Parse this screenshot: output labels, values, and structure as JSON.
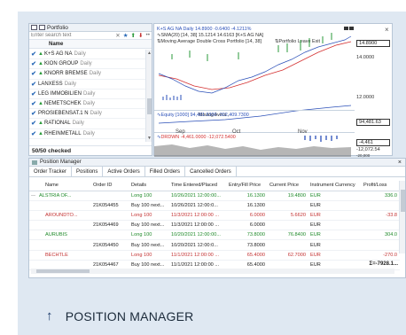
{
  "portfolio": {
    "title": "Portfolio",
    "search_placeholder": "Enter search text",
    "column_name": "Name",
    "items": [
      {
        "name": "K+S AG NA",
        "timeframe": "Daily"
      },
      {
        "name": "KION GROUP",
        "timeframe": "Daily"
      },
      {
        "name": "KNORR BREMSE",
        "timeframe": "Daily"
      },
      {
        "name": "LANXESS",
        "timeframe": "Daily"
      },
      {
        "name": "LEG IMMOBILIEN",
        "timeframe": "Daily"
      },
      {
        "name": "NEMETSCHEK",
        "timeframe": "Daily"
      },
      {
        "name": "PROSIEBENSAT.1 N",
        "timeframe": "Daily"
      },
      {
        "name": "RATIONAL",
        "timeframe": "Daily"
      },
      {
        "name": "RHEINMETALL",
        "timeframe": "Daily"
      }
    ],
    "footer": "50/50 checked"
  },
  "chart": {
    "header": "K+S AG NA  Daily 14.8900 -0.6400 -4.1211%",
    "sma_line": "SMA(20) [14, 38] 15.1214 14.6163 [K+S AG NA]",
    "strategy_line": "Moving Average Double Cross Portfolio [14, 38]",
    "exit_label": "Portfolio Leave Exit",
    "inline_label": "Moving Avera...",
    "price_axis": [
      "14.8900",
      "14.0000",
      "12.0000"
    ],
    "equity_label": "Equity [1000] 94,481.6300 -302,409.7300",
    "equity_value": "94,481.63",
    "drawdown_label": "DRDWN -4,461.0000 -12,072.5400",
    "drawdown_values": [
      "-4,461",
      "-12,072.54",
      "-20,000"
    ],
    "months": [
      "Sep",
      "Oct",
      "Nov"
    ]
  },
  "position_manager": {
    "title": "Position Manager",
    "tabs": [
      "Order Tracker",
      "Positions",
      "Active Orders",
      "Filled Orders",
      "Cancelled Orders"
    ],
    "columns": [
      "Name",
      "Order ID",
      "Details",
      "Time Entered/Placed",
      "Entry/Fill Price",
      "Current Price",
      "Instrument Currency",
      "Profit/Loss"
    ],
    "rows": [
      {
        "name": "ALSTRIA OF...",
        "order_id": "",
        "details": "Long 100",
        "time": "10/26/2021 12:00:00...",
        "entry": "16.1300",
        "current": "19.4800",
        "currency": "EUR",
        "pl": "336.0",
        "color": "green"
      },
      {
        "name": "",
        "order_id": "21K054455",
        "details": "Buy 100 next...",
        "time": "10/26/2021 12:00:0...",
        "entry": "16.1300",
        "current": "",
        "currency": "EUR",
        "pl": "",
        "color": "dark"
      },
      {
        "name": "AROUNDTO...",
        "order_id": "",
        "details": "Long 100",
        "time": "11/3/2021 12:00:00 ...",
        "entry": "6.0000",
        "current": "5.6620",
        "currency": "EUR",
        "pl": "-33.8",
        "color": "red"
      },
      {
        "name": "",
        "order_id": "21K054469",
        "details": "Buy 100 next...",
        "time": "11/3/2021 12:00:00 ...",
        "entry": "6.0000",
        "current": "",
        "currency": "EUR",
        "pl": "",
        "color": "dark"
      },
      {
        "name": "AURUBIS",
        "order_id": "",
        "details": "Long 100",
        "time": "10/20/2021 12:00:00...",
        "entry": "73.8000",
        "current": "76.8400",
        "currency": "EUR",
        "pl": "304.0",
        "color": "green"
      },
      {
        "name": "",
        "order_id": "21K054450",
        "details": "Buy 100 next...",
        "time": "10/20/2021 12:00:0...",
        "entry": "73.8000",
        "current": "",
        "currency": "EUR",
        "pl": "",
        "color": "dark"
      },
      {
        "name": "BECHTLE",
        "order_id": "",
        "details": "Long 100",
        "time": "11/1/2021 12:00:00 ...",
        "entry": "65.4000",
        "current": "62.7000",
        "currency": "EUR",
        "pl": "-270.0",
        "color": "red"
      },
      {
        "name": "",
        "order_id": "21K054467",
        "details": "Buy 100 next...",
        "time": "11/1/2021 12:00:00 ...",
        "entry": "65.4000",
        "current": "",
        "currency": "EUR",
        "pl": "",
        "color": "dark"
      }
    ],
    "sum": "Σ=-7928.1..."
  },
  "caption": {
    "text": "POSITION MANAGER"
  },
  "colors": {
    "accent": "#2a6ab8",
    "profit": "#1f8a2a",
    "loss": "#c43232",
    "frame": "#dfe8f2"
  }
}
